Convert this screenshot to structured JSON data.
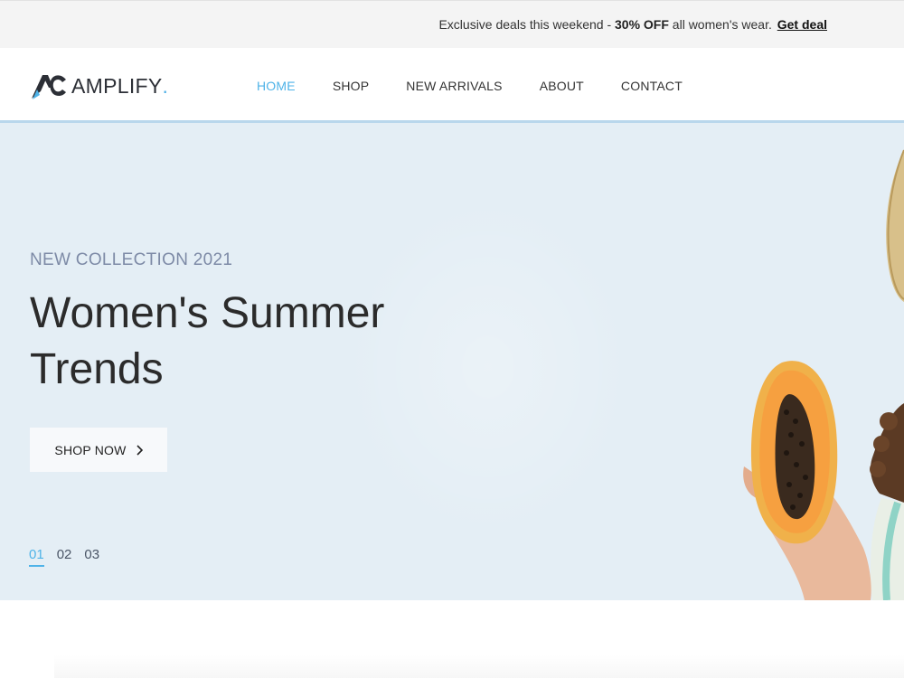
{
  "announcement": {
    "prefix": "Exclusive deals this weekend - ",
    "highlight": "30% OFF",
    "suffix": " all women's wear.",
    "link_label": "Get deal"
  },
  "brand": {
    "name": "AMPLIFY",
    "dot": ".",
    "accent_color": "#4fb3e8"
  },
  "nav": {
    "items": [
      {
        "label": "HOME",
        "active": true
      },
      {
        "label": "SHOP",
        "active": false
      },
      {
        "label": "NEW ARRIVALS",
        "active": false
      },
      {
        "label": "ABOUT",
        "active": false
      },
      {
        "label": "CONTACT",
        "active": false
      }
    ]
  },
  "hero": {
    "eyebrow": "NEW COLLECTION 2021",
    "title_line1": "Women's Summer",
    "title_line2": "Trends",
    "cta_label": "SHOP NOW",
    "cta_icon": "chevron-right-icon",
    "background_color": "#e4eef5",
    "slides": [
      {
        "label": "01",
        "active": true
      },
      {
        "label": "02",
        "active": false
      },
      {
        "label": "03",
        "active": false
      }
    ]
  }
}
